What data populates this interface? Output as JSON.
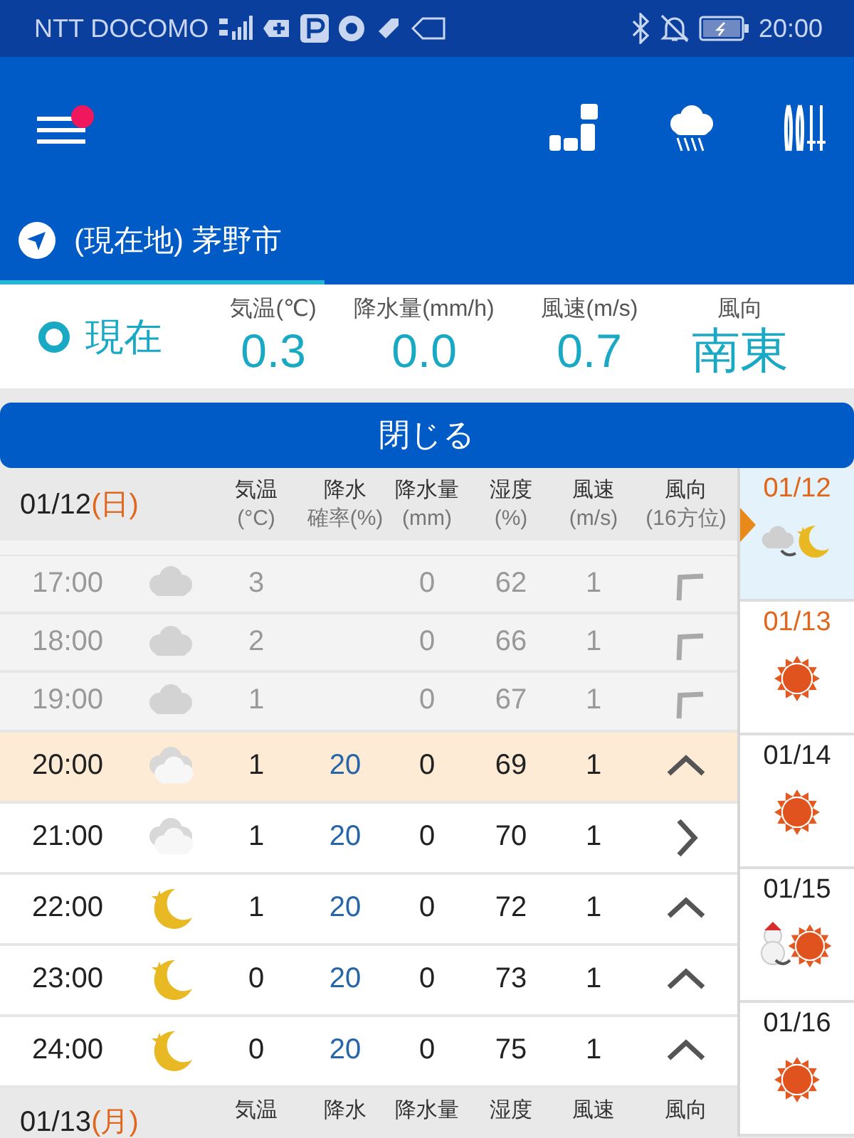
{
  "status_bar": {
    "carrier": "NTT DOCOMO",
    "time": "20:00"
  },
  "location_tabs": [
    {
      "label": "(現在地) 茅野市",
      "selected": true
    }
  ],
  "current": {
    "label": "現在",
    "readings": [
      {
        "label": "気温(℃)",
        "value": "0.3",
        "kind": "number"
      },
      {
        "label": "降水量(mm/h)",
        "value": "0.0",
        "kind": "number"
      },
      {
        "label": "風速(m/s)",
        "value": "0.7",
        "kind": "number"
      },
      {
        "label": "風向",
        "value": "南東",
        "kind": "direction"
      }
    ]
  },
  "close_button": "閉じる",
  "hourly": {
    "date": "01/12",
    "weekday": "(日)",
    "holiday": true,
    "columns": [
      [
        "気温",
        "(°C)"
      ],
      [
        "降水",
        "確率(%)"
      ],
      [
        "降水量",
        "(mm)"
      ],
      [
        "湿度",
        "(%)"
      ],
      [
        "風速",
        "(m/s)"
      ],
      [
        "風向",
        "(16方位)"
      ]
    ],
    "rows": [
      {
        "time": "17:00",
        "weather": {
          "kind": "cloudy"
        },
        "temp": "3",
        "prob": "",
        "amount": "0",
        "humidity": "62",
        "speed": "1",
        "wind": {
          "kind": "nw"
        },
        "past": true,
        "selected": false
      },
      {
        "time": "18:00",
        "weather": {
          "kind": "cloudy"
        },
        "temp": "2",
        "prob": "",
        "amount": "0",
        "humidity": "66",
        "speed": "1",
        "wind": {
          "kind": "nw"
        },
        "past": true,
        "selected": false
      },
      {
        "time": "19:00",
        "weather": {
          "kind": "cloudy"
        },
        "temp": "1",
        "prob": "",
        "amount": "0",
        "humidity": "67",
        "speed": "1",
        "wind": {
          "kind": "nw"
        },
        "past": true,
        "selected": false
      },
      {
        "time": "20:00",
        "weather": {
          "kind": "cloud_light"
        },
        "temp": "1",
        "prob": "20",
        "amount": "0",
        "humidity": "69",
        "speed": "1",
        "wind": {
          "kind": "n"
        },
        "past": false,
        "selected": true
      },
      {
        "time": "21:00",
        "weather": {
          "kind": "cloud_light"
        },
        "temp": "1",
        "prob": "20",
        "amount": "0",
        "humidity": "70",
        "speed": "1",
        "wind": {
          "kind": "e"
        },
        "past": false,
        "selected": false
      },
      {
        "time": "22:00",
        "weather": {
          "kind": "moon"
        },
        "temp": "1",
        "prob": "20",
        "amount": "0",
        "humidity": "72",
        "speed": "1",
        "wind": {
          "kind": "n"
        },
        "past": false,
        "selected": false
      },
      {
        "time": "23:00",
        "weather": {
          "kind": "moon"
        },
        "temp": "0",
        "prob": "20",
        "amount": "0",
        "humidity": "73",
        "speed": "1",
        "wind": {
          "kind": "n"
        },
        "past": false,
        "selected": false
      },
      {
        "time": "24:00",
        "weather": {
          "kind": "moon"
        },
        "temp": "0",
        "prob": "20",
        "amount": "0",
        "humidity": "75",
        "speed": "1",
        "wind": {
          "kind": "n"
        },
        "past": false,
        "selected": false
      }
    ],
    "next_header": {
      "date": "01/13",
      "weekday": "(月)",
      "holiday": true,
      "columns": [
        "気温",
        "降水",
        "降水量",
        "湿度",
        "風速",
        "風向"
      ]
    }
  },
  "days": [
    {
      "date": "01/12",
      "holiday": true,
      "weather": {
        "kind": "cloudy_to_moon"
      },
      "selected": true
    },
    {
      "date": "01/13",
      "holiday": true,
      "weather": {
        "kind": "sun"
      },
      "selected": false
    },
    {
      "date": "01/14",
      "holiday": false,
      "weather": {
        "kind": "sun"
      },
      "selected": false
    },
    {
      "date": "01/15",
      "holiday": false,
      "weather": {
        "kind": "snow_to_sun"
      },
      "selected": false
    },
    {
      "date": "01/16",
      "holiday": false,
      "weather": {
        "kind": "sun"
      },
      "selected": false
    }
  ]
}
